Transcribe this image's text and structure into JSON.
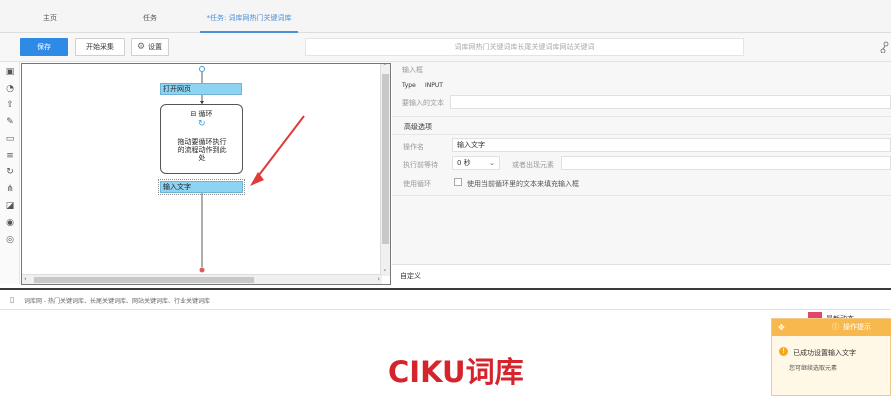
{
  "tabs": [
    {
      "label": "主页",
      "active": false
    },
    {
      "label": "任务",
      "active": false
    },
    {
      "label": "*任务: 词库网热门关键词库长...",
      "active": true
    }
  ],
  "toolbar": {
    "save_label": "保存",
    "start_label": "开始采集",
    "settings_label": "设置",
    "url_text": "词库网热门关键词库长尾关键词库网站关键词"
  },
  "flow": {
    "open_page": "打开网页",
    "loop_label": "循环",
    "loop_hint": "拖动要循环执行的流程动作到此处",
    "input_text": "输入文字"
  },
  "props": {
    "section_input": "输入框",
    "type_label": "Type",
    "type_value": "INPUT",
    "text_label": "要输入的文本",
    "advanced": "高级选项",
    "op_name_label": "操作名",
    "op_name_value": "输入文字",
    "wait_label": "执行前等待",
    "wait_value": "0 秒",
    "appear_label": "或者出现元素",
    "use_loop_label": "使用循环",
    "use_loop_text": "使用当前循环里的文本来填充输入框",
    "custom_label": "自定义"
  },
  "statusbar": {
    "text": "词库网 - 热门关键词库、长尾关键词库、网站关键词库、行业关键词库"
  },
  "browser": {
    "logo_ciku": "CIKU",
    "logo_cn": "词库",
    "logo_color": "#d5242c",
    "badge_text": "最新动态"
  },
  "tip": {
    "title": "操作提示",
    "message": "已成功设置输入文字",
    "sub": "您可继续选取元素"
  },
  "colors": {
    "accent": "#2f8ae6",
    "node": "#8fd3f2",
    "arrow": "#e03a3a",
    "tip_header": "#f7b94d"
  }
}
